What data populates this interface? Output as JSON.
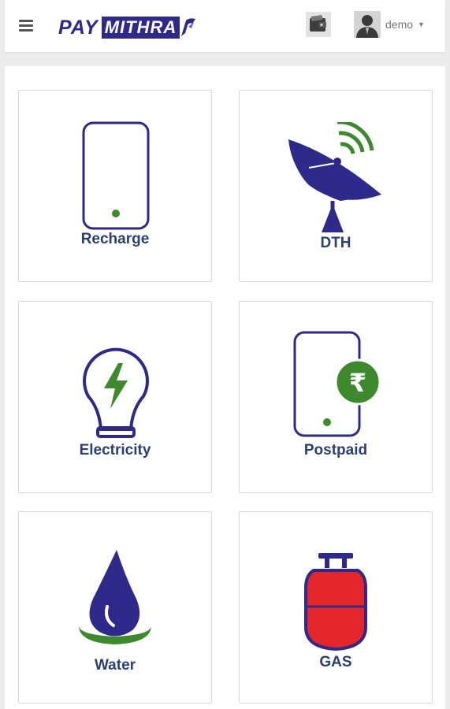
{
  "app": {
    "brand_part1": "PAY",
    "brand_part2": "MITHRA",
    "username": "demo"
  },
  "icons": {
    "menu": "hamburger-menu-icon",
    "wallet": "wallet-icon",
    "user": "user-avatar-icon",
    "caret": "chevron-down-icon"
  },
  "colors": {
    "brand_navy": "#2d2a8c",
    "label_blue": "#2b3f75",
    "accent_green": "#3d8a2e",
    "gas_red": "#e2262b"
  },
  "services": [
    {
      "label": "Recharge",
      "icon": "mobile-phone-icon"
    },
    {
      "label": "DTH",
      "icon": "satellite-dish-icon"
    },
    {
      "label": "Electricity",
      "icon": "light-bulb-icon"
    },
    {
      "label": "Postpaid",
      "icon": "rupee-phone-icon"
    },
    {
      "label": "Water",
      "icon": "water-drop-icon"
    },
    {
      "label": "GAS",
      "icon": "gas-cylinder-icon"
    }
  ]
}
